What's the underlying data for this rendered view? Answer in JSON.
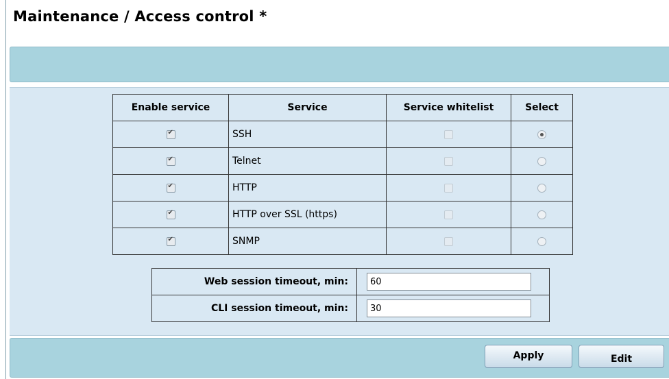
{
  "page": {
    "title": "Maintenance / Access control *"
  },
  "services_table": {
    "headers": {
      "enable": "Enable service",
      "service": "Service",
      "whitelist": "Service whitelist",
      "select": "Select"
    },
    "rows": [
      {
        "name": "SSH",
        "enabled": true,
        "whitelist": false,
        "selected": true
      },
      {
        "name": "Telnet",
        "enabled": true,
        "whitelist": false,
        "selected": false
      },
      {
        "name": "HTTP",
        "enabled": true,
        "whitelist": false,
        "selected": false
      },
      {
        "name": "HTTP over SSL (https)",
        "enabled": true,
        "whitelist": false,
        "selected": false
      },
      {
        "name": "SNMP",
        "enabled": true,
        "whitelist": false,
        "selected": false
      }
    ]
  },
  "timeouts": {
    "web_label": "Web session timeout, min:",
    "web_value": "60",
    "cli_label": "CLI session timeout, min:",
    "cli_value": "30"
  },
  "buttons": {
    "apply": "Apply",
    "edit": "Edit"
  },
  "colors": {
    "band": "#a8d3de",
    "panel": "#d9e8f3"
  }
}
